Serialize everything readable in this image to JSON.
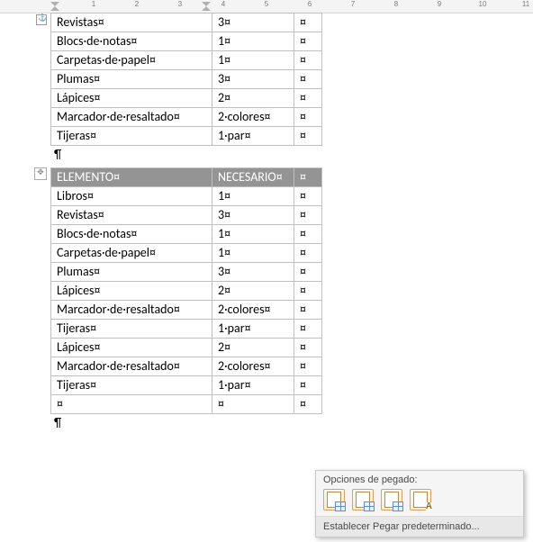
{
  "ruler": {
    "marks": [
      "1",
      "2",
      "3",
      "4",
      "5",
      "6",
      "7",
      "8",
      "9",
      "10",
      "11"
    ]
  },
  "cellMark": "¤",
  "dot": "·",
  "paraMark": "¶",
  "table1": {
    "rows": [
      {
        "a": "Revistas",
        "b": "3"
      },
      {
        "a": "Blocs·de·notas",
        "b": "1"
      },
      {
        "a": "Carpetas·de·papel",
        "b": "1"
      },
      {
        "a": "Plumas",
        "b": "3"
      },
      {
        "a": "Lápices",
        "b": "2"
      },
      {
        "a": "Marcador·de·resaltado",
        "b": "2·colores"
      },
      {
        "a": "Tijeras",
        "b": "1·par"
      }
    ]
  },
  "table2": {
    "header": {
      "a": "ELEMENTO",
      "b": "NECESARIO"
    },
    "rows": [
      {
        "a": "Libros",
        "b": "1"
      },
      {
        "a": "Revistas",
        "b": "3"
      },
      {
        "a": "Blocs·de·notas",
        "b": "1"
      },
      {
        "a": "Carpetas·de·papel",
        "b": "1"
      },
      {
        "a": "Plumas",
        "b": "3"
      },
      {
        "a": "Lápices",
        "b": "2"
      },
      {
        "a": "Marcador·de·resaltado",
        "b": "2·colores"
      },
      {
        "a": "Tijeras",
        "b": "1·par"
      },
      {
        "a": "Lápices",
        "b": "2"
      },
      {
        "a": "Marcador·de·resaltado",
        "b": "2·colores"
      },
      {
        "a": "Tijeras",
        "b": "1·par"
      },
      {
        "a": "",
        "b": ""
      }
    ]
  },
  "paste": {
    "title": "Opciones de pegado:",
    "setDefault": "Establecer Pegar predeterminado..."
  }
}
